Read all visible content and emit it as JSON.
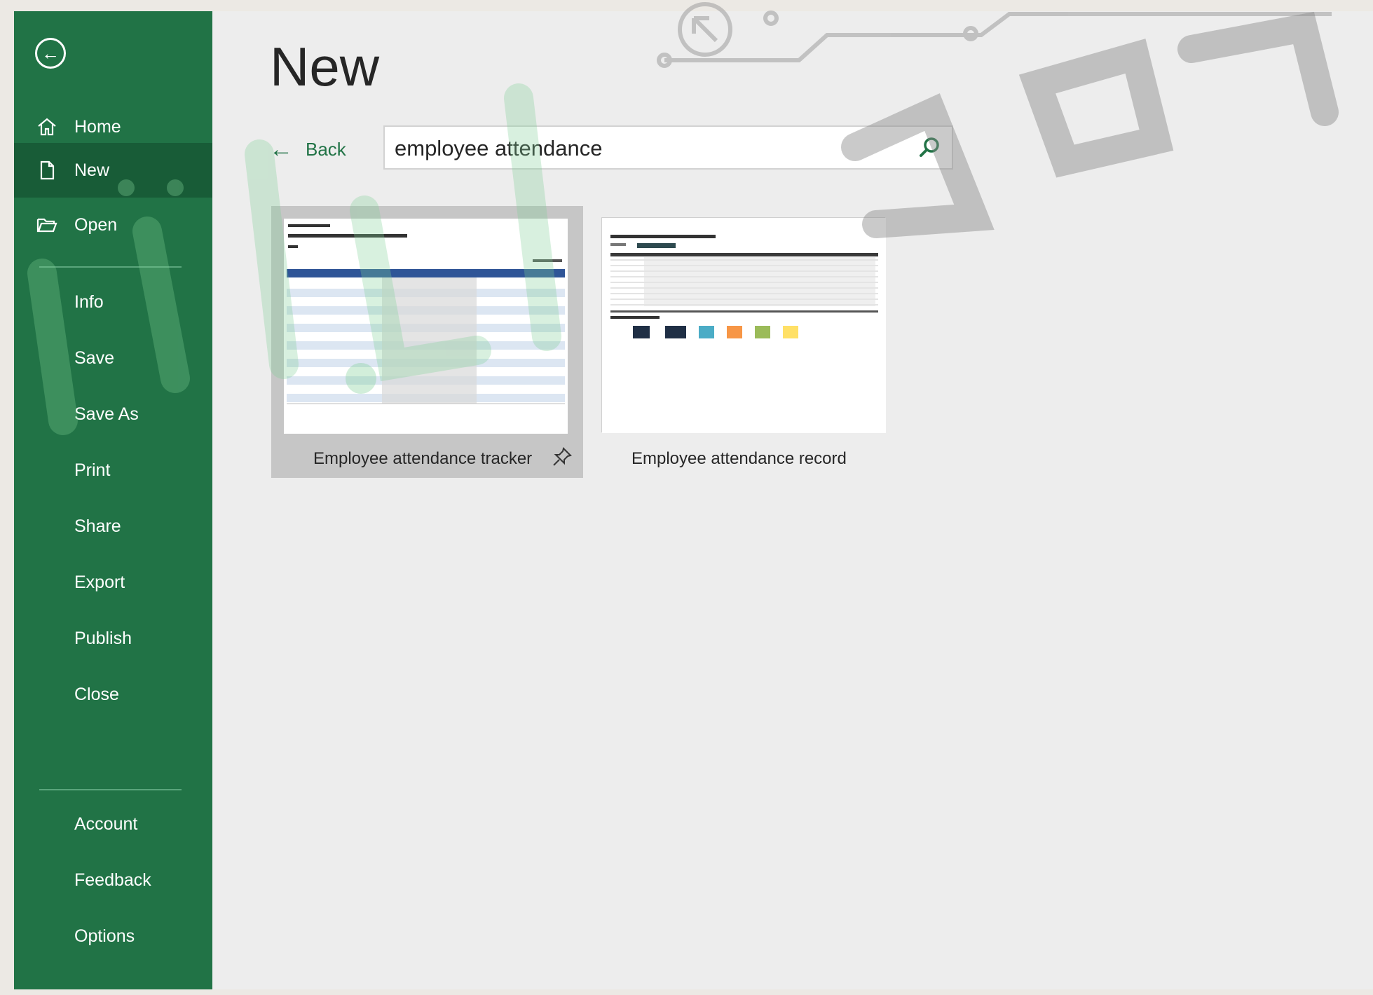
{
  "sidebar": {
    "back_icon": "back-arrow-circle-icon",
    "items": [
      {
        "label": "Home",
        "icon": "home-icon"
      },
      {
        "label": "New",
        "icon": "new-document-icon"
      },
      {
        "label": "Open",
        "icon": "open-folder-icon"
      },
      {
        "label": "Info"
      },
      {
        "label": "Save"
      },
      {
        "label": "Save As"
      },
      {
        "label": "Print"
      },
      {
        "label": "Share"
      },
      {
        "label": "Export"
      },
      {
        "label": "Publish"
      },
      {
        "label": "Close"
      },
      {
        "label": "Account"
      },
      {
        "label": "Feedback"
      },
      {
        "label": "Options"
      }
    ],
    "active": "New"
  },
  "main": {
    "title": "New",
    "back_label": "Back",
    "search": {
      "value": "employee attendance",
      "icon": "search-icon"
    },
    "templates": [
      {
        "name": "Employee attendance tracker",
        "pinned_icon": "pin-icon"
      },
      {
        "name": "Employee attendance record"
      }
    ]
  },
  "colors": {
    "sidebar": "#217346",
    "sidebar_active": "#185c37",
    "accent": "#217346",
    "background": "#ededed"
  }
}
